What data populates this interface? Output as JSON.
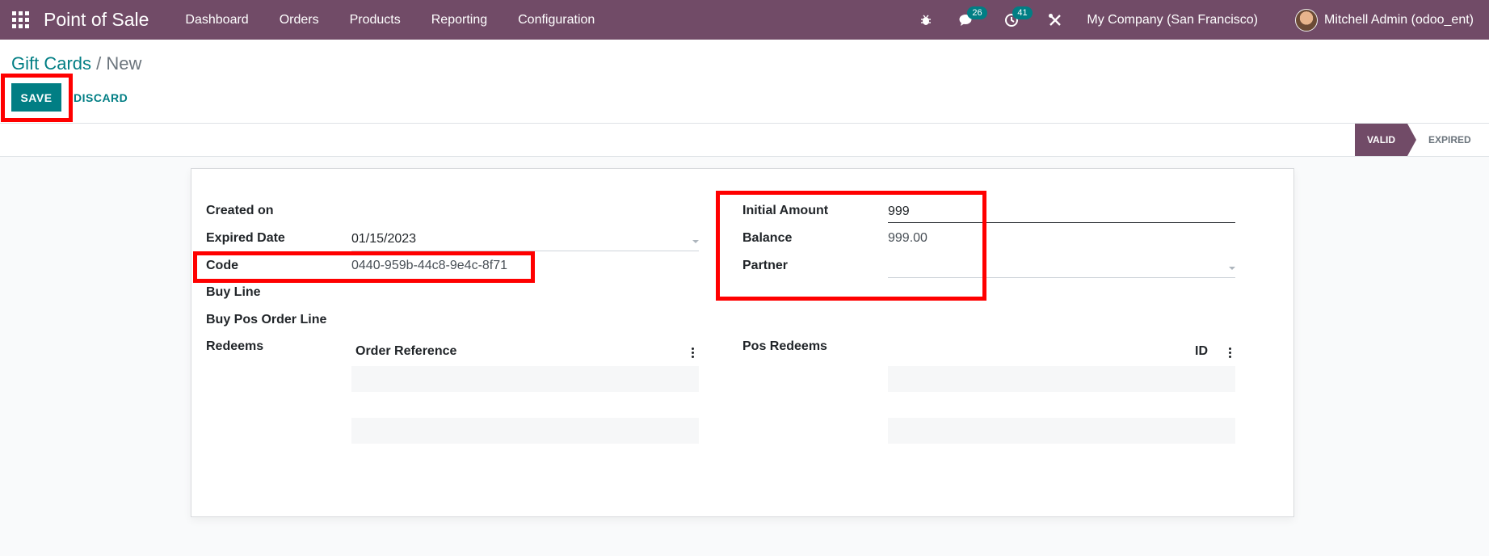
{
  "navbar": {
    "app_title": "Point of Sale",
    "menu": [
      "Dashboard",
      "Orders",
      "Products",
      "Reporting",
      "Configuration"
    ],
    "messages_count": "26",
    "activities_count": "41",
    "company": "My Company (San Francisco)",
    "user": "Mitchell Admin (odoo_ent)",
    "icons": [
      "apps-grid-icon",
      "bug-icon",
      "chat-icon",
      "clock-icon",
      "tools-icon"
    ]
  },
  "breadcrumb": {
    "parent": "Gift Cards",
    "separator": " / ",
    "current": "New"
  },
  "actions": {
    "save": "SAVE",
    "discard": "DISCARD"
  },
  "statusbar": {
    "stages": [
      "VALID",
      "EXPIRED"
    ],
    "active": "VALID"
  },
  "form": {
    "left": {
      "created_on_label": "Created on",
      "created_on_value": "",
      "expired_date_label": "Expired Date",
      "expired_date_value": "01/15/2023",
      "code_label": "Code",
      "code_value": "0440-959b-44c8-9e4c-8f71",
      "buy_line_label": "Buy Line",
      "buy_pos_order_line_label": "Buy Pos Order Line",
      "redeems_label": "Redeems",
      "redeems_columns": [
        "Order Reference"
      ]
    },
    "right": {
      "initial_amount_label": "Initial Amount",
      "initial_amount_value": "999",
      "balance_label": "Balance",
      "balance_value": "999.00",
      "partner_label": "Partner",
      "partner_value": "",
      "pos_redeems_label": "Pos Redeems",
      "pos_redeems_columns": [
        "ID"
      ]
    }
  },
  "colors": {
    "brand": "#714b67",
    "accent": "#017e84",
    "annotation": "#ff0000"
  }
}
